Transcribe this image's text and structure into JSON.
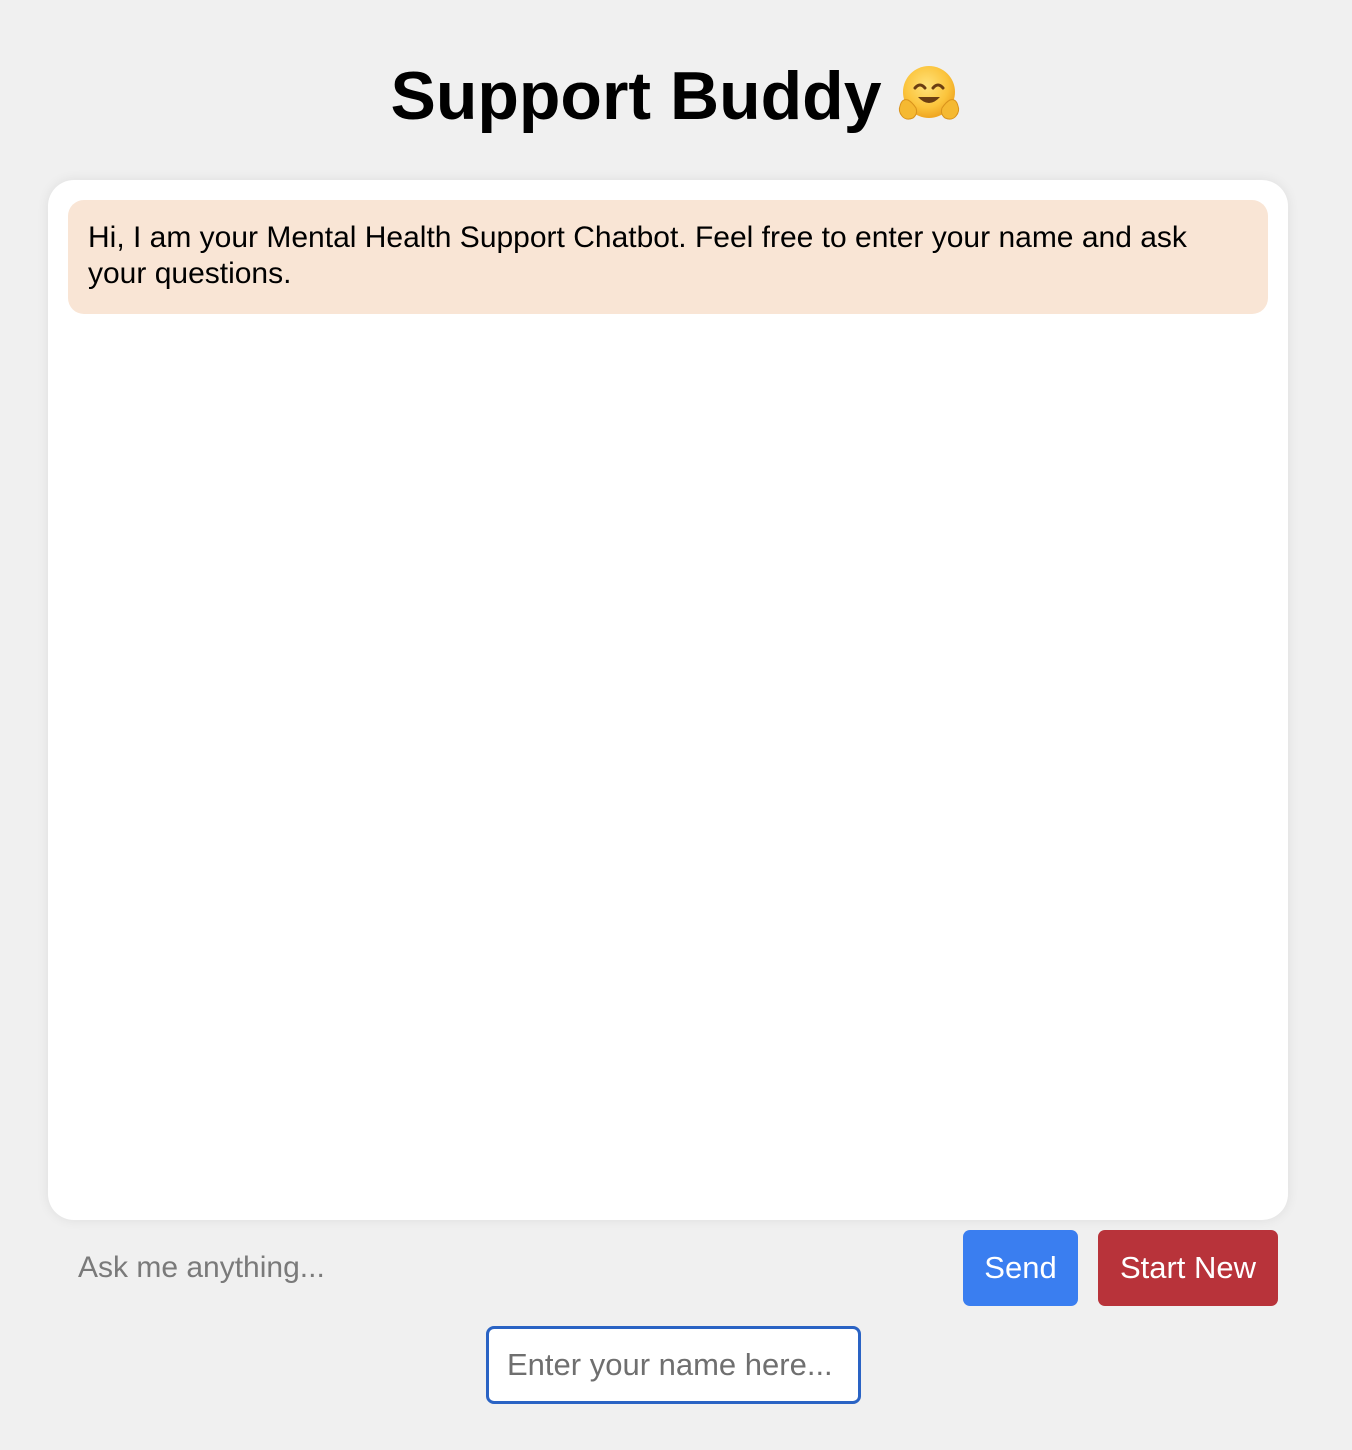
{
  "header": {
    "title": "Support Buddy",
    "emoji_icon": "hugging-face-icon"
  },
  "chat": {
    "messages": [
      {
        "sender": "bot",
        "text": "Hi, I am your Mental Health Support Chatbot. Feel free to enter your name and ask your questions."
      }
    ],
    "bot_bubble_color": "#f9e5d5"
  },
  "composer": {
    "message_placeholder": "Ask me anything...",
    "message_value": "",
    "send_label": "Send",
    "start_new_label": "Start New",
    "send_color": "#3a7ef0",
    "start_new_color": "#b8333a"
  },
  "name_entry": {
    "placeholder": "Enter your name here...",
    "value": "",
    "focus_border_color": "#2a63c4"
  }
}
